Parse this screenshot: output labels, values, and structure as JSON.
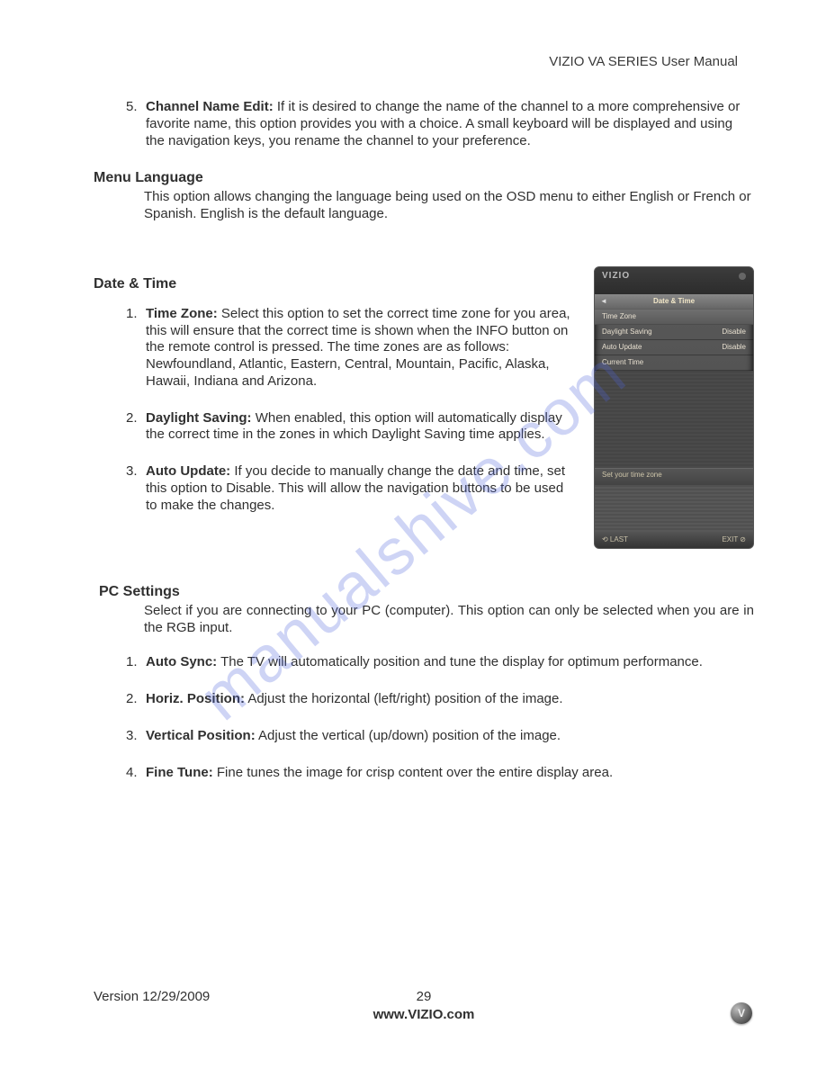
{
  "header": {
    "right": "VIZIO VA SERIES User Manual"
  },
  "item5": {
    "num": "5.",
    "label": "Channel Name Edit:",
    "text": " If it is desired to change the name of the channel to a more comprehensive or favorite name, this option provides you with a choice. A small keyboard will be displayed and using the navigation keys, you rename the channel to your preference."
  },
  "menuLang": {
    "title": "Menu Language",
    "text": "This option allows changing the language being used on the OSD menu to either English or French or Spanish. English is the default language."
  },
  "dateTime": {
    "title": "Date & Time",
    "items": [
      {
        "num": "1.",
        "label": "Time Zone:",
        "text": " Select this option to set the correct time zone for you area, this will ensure that the correct time is shown when the INFO button on the remote control is pressed. The time zones are as follows: Newfoundland, Atlantic, Eastern, Central, Mountain, Pacific, Alaska, Hawaii, Indiana and Arizona."
      },
      {
        "num": "2.",
        "label": "Daylight Saving:",
        "text": " When enabled, this option will automatically display the correct time in the zones in which Daylight Saving time applies."
      },
      {
        "num": "3.",
        "label": "Auto Update:",
        "text": " If you decide to manually change the date and time, set this option to Disable. This will allow the navigation buttons to be used to make the changes."
      }
    ]
  },
  "osd": {
    "brand": "VIZIO",
    "header": "Date & Time",
    "back": "◄",
    "rows": [
      {
        "label": "Time Zone",
        "value": ""
      },
      {
        "label": "Daylight Saving",
        "value": "Disable"
      },
      {
        "label": "Auto Update",
        "value": "Disable"
      },
      {
        "label": "Current Time",
        "value": ""
      }
    ],
    "hint": "Set your time zone",
    "lastLabel": "⟲ LAST",
    "exitLabel": "EXIT ⊘"
  },
  "pc": {
    "title": "PC Settings",
    "text": "Select if you are connecting to your PC (computer). This option can only be selected when you are in the RGB input.",
    "items": [
      {
        "num": "1.",
        "label": "Auto Sync:",
        "text": " The TV will automatically position and tune the display for optimum performance."
      },
      {
        "num": "2.",
        "label": "Horiz. Position:",
        "text": " Adjust the horizontal (left/right) position of the image."
      },
      {
        "num": "3.",
        "label": "Vertical Position:",
        "text": " Adjust the vertical (up/down) position of the image."
      },
      {
        "num": "4.",
        "label": "Fine Tune:",
        "text": " Fine tunes the image for crisp content over the entire display area."
      }
    ]
  },
  "watermark": "manualshive.com",
  "footer": {
    "version": "Version 12/29/2009",
    "page": "29",
    "url": "www.VIZIO.com",
    "logo": "V"
  }
}
